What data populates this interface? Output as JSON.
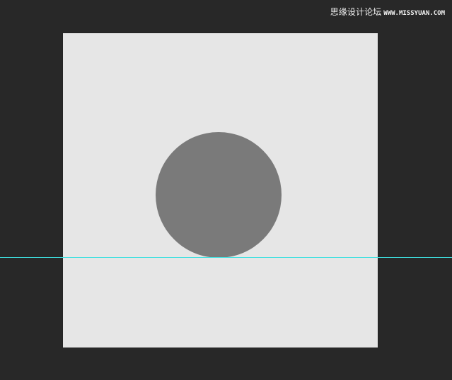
{
  "watermark": {
    "chinese": "思缘设计论坛",
    "url": "WWW.MISSYUAN.COM"
  },
  "colors": {
    "workspace_background": "#282828",
    "canvas_fill": "#e6e6e6",
    "circle_fill": "#7a7a7a",
    "guide_color": "#3ee0e0"
  },
  "objects": {
    "canvas": "canvas-document",
    "shape": "circle-shape",
    "guide": "horizontal-guide"
  }
}
